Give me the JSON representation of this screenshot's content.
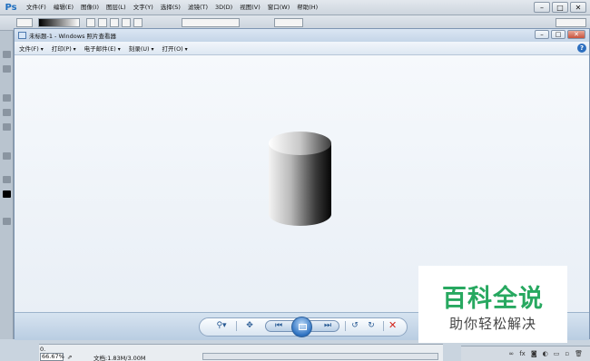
{
  "photoshop": {
    "logo": "Ps",
    "menus": [
      "文件(F)",
      "编辑(E)",
      "图像(I)",
      "图层(L)",
      "文字(Y)",
      "选择(S)",
      "滤镜(T)",
      "3D(D)",
      "视图(V)",
      "窗口(W)",
      "帮助(H)"
    ],
    "status": {
      "zoom_top": "0.",
      "zoom": "66.67%",
      "doc_info": "文档:1.83M/3.00M"
    }
  },
  "photo_viewer": {
    "title": "未标题-1 - Windows 照片查看器",
    "menus": [
      "文件(F)",
      "打印(P)",
      "电子邮件(E)",
      "刻录(U)",
      "打开(O)"
    ],
    "help_label": "?",
    "controls": {
      "zoom": "zoom-icon",
      "fit": "actual-size-icon",
      "prev": "previous-icon",
      "slideshow": "slideshow-icon",
      "next": "next-icon",
      "rotate_ccw": "rotate-counterclockwise-icon",
      "rotate_cw": "rotate-clockwise-icon",
      "delete": "delete-icon"
    },
    "accent": "#2f73c2"
  },
  "watermark": {
    "main": "百科全说",
    "sub": "助你轻松解决",
    "color": "#27a860"
  }
}
